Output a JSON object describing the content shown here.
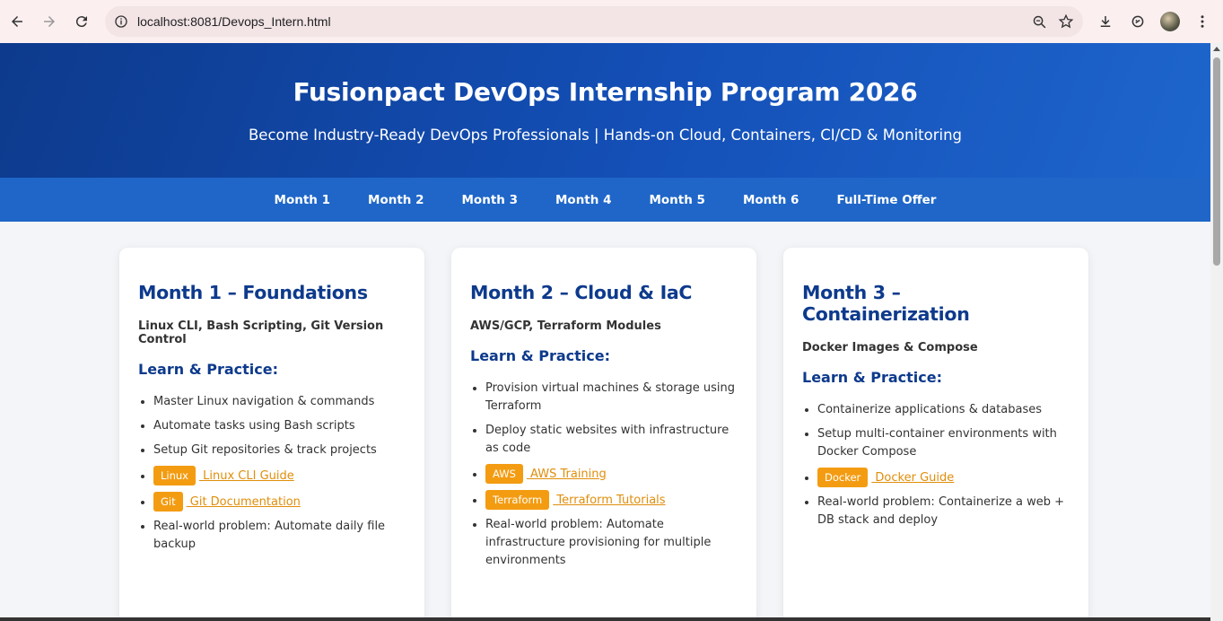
{
  "browser": {
    "url": "localhost:8081/Devops_Intern.html",
    "icons": [
      "back-icon",
      "forward-icon",
      "reload-icon",
      "site-info-icon",
      "zoom-icon",
      "star-icon",
      "download-icon",
      "extension-icon",
      "profile-avatar",
      "menu-icon"
    ]
  },
  "hero": {
    "title": "Fusionpact DevOps Internship Program 2026",
    "subtitle": "Become Industry-Ready DevOps Professionals | Hands-on Cloud, Containers, CI/CD & Monitoring"
  },
  "nav": {
    "items": [
      "Month 1",
      "Month 2",
      "Month 3",
      "Month 4",
      "Month 5",
      "Month 6",
      "Full-Time Offer"
    ]
  },
  "cards": [
    {
      "title": "Month 1 – Foundations",
      "subtitle": "Linux CLI, Bash Scripting, Git Version Control",
      "section": "Learn & Practice:",
      "items": [
        "Master Linux navigation & commands",
        "Automate tasks using Bash scripts",
        "Setup Git repositories & track projects"
      ],
      "links": [
        {
          "tag": "Linux",
          "text": " Linux CLI Guide"
        },
        {
          "tag": "Git",
          "text": " Git Documentation"
        }
      ],
      "problem": "Real-world problem: Automate daily file backup"
    },
    {
      "title": "Month 2 – Cloud & IaC",
      "subtitle": "AWS/GCP, Terraform Modules",
      "section": "Learn & Practice:",
      "items": [
        "Provision virtual machines & storage using Terraform",
        "Deploy static websites with infrastructure as code"
      ],
      "links": [
        {
          "tag": "AWS",
          "text": " AWS Training"
        },
        {
          "tag": "Terraform",
          "text": " Terraform Tutorials"
        }
      ],
      "problem": "Real-world problem: Automate infrastructure provisioning for multiple environments"
    },
    {
      "title": "Month 3 – Containerization",
      "subtitle": "Docker Images & Compose",
      "section": "Learn & Practice:",
      "items": [
        "Containerize applications & databases",
        "Setup multi-container environments with Docker Compose"
      ],
      "links": [
        {
          "tag": "Docker",
          "text": " Docker Guide"
        }
      ],
      "problem": "Real-world problem: Containerize a web + DB stack and deploy"
    }
  ],
  "colors": {
    "hero_start": "#0d3a8c",
    "nav_bg": "#1f66c8",
    "heading": "#0d3a8c",
    "tag_bg": "#f39c12",
    "link": "#e08e0b"
  }
}
